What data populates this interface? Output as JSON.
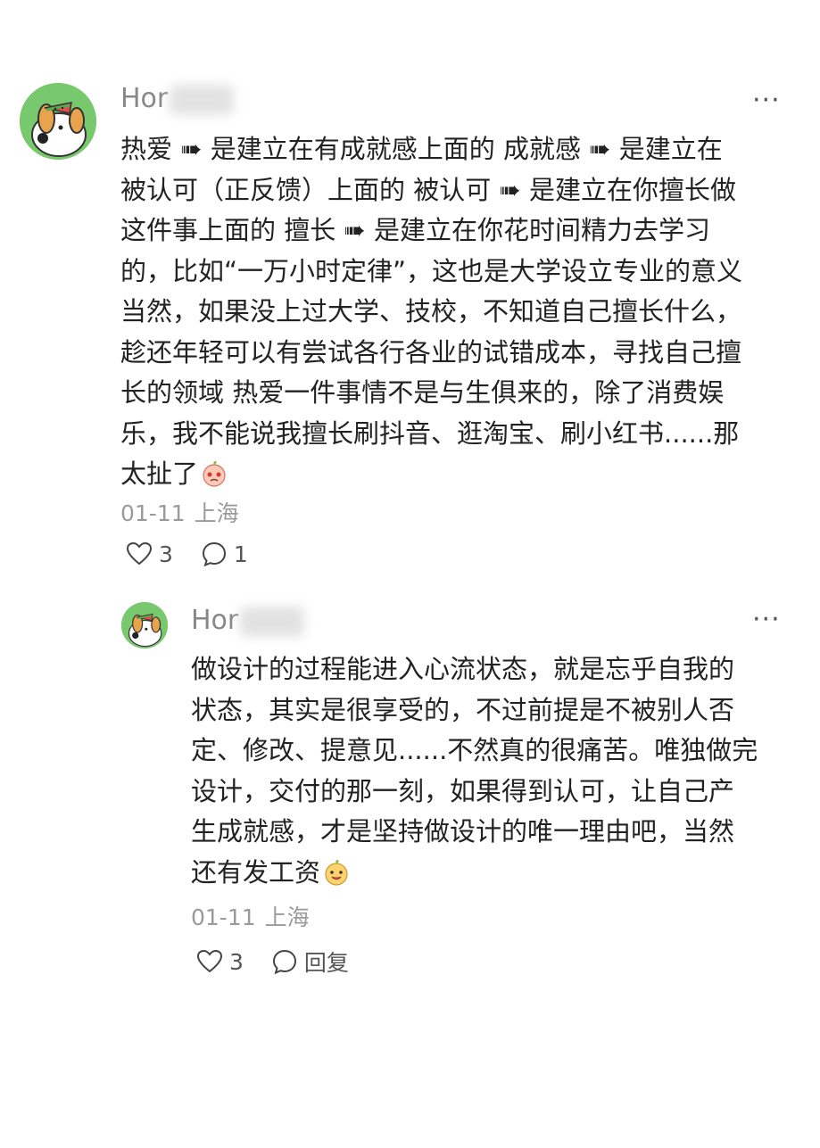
{
  "comments": [
    {
      "username": "Hor",
      "lines": [
        "热爱 ➠ 是建立在有成就感上面的 成就感 ➠ 是建立在",
        "被认可（正反馈）上面的 被认可 ➠ 是建立在你擅长做",
        "这件事上面的 擅长 ➠ 是建立在你花时间精力去学习",
        "的，比如“一万小时定律”，这也是大学设立专业的意义",
        "当然，如果没上过大学、技校，不知道自己擅长什么，",
        "趁还年轻可以有尝试各行各业的试错成本，寻找自己擅",
        "长的领域 热爱一件事情不是与生俱来的，除了消费娱",
        "乐，我不能说我擅长刷抖音、逛淘宝、刷小红书......那",
        "太扯了"
      ],
      "date": "01-11",
      "location": "上海",
      "likes": "3",
      "reply_label": "1",
      "more_label": "···"
    },
    {
      "username": "Hor",
      "lines": [
        "做设计的过程能进入心流状态，就是忘乎自我的",
        "状态，其实是很享受的，不过前提是不被别人否",
        "定、修改、提意见......不然真的很痛苦。唯独做完",
        "设计，交付的那一刻，如果得到认可，让自己产",
        "生成就感，才是坚持做设计的唯一理由吧，当然",
        "还有发工资"
      ],
      "date": "01-11",
      "location": "上海",
      "likes": "3",
      "reply_label": "回复",
      "more_label": "···"
    }
  ],
  "colors": {
    "avatar_bg": "#78c86e",
    "text": "#222222",
    "meta": "#9a9a9a"
  }
}
